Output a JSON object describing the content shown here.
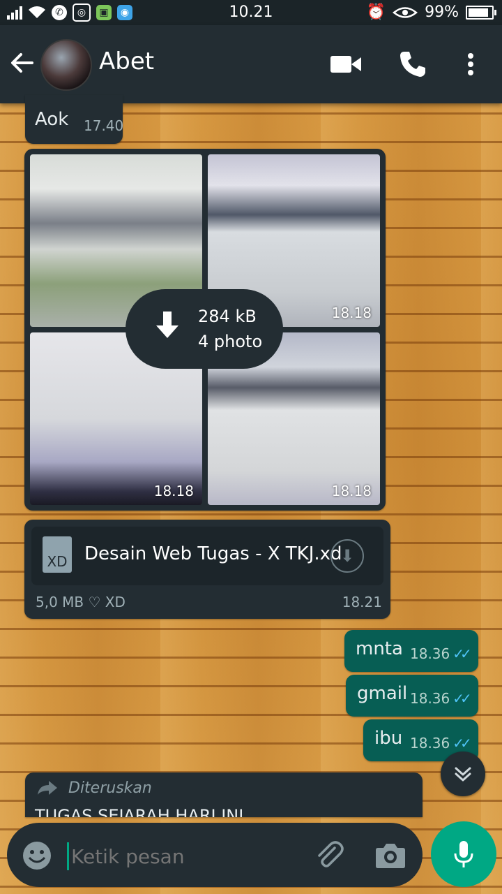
{
  "status_bar": {
    "time": "10.21",
    "battery": "99%",
    "battery_level": 0.99
  },
  "header": {
    "contact_name": "Abet",
    "icons": [
      "back-arrow-icon",
      "video-call-icon",
      "voice-call-icon",
      "more-options-icon"
    ]
  },
  "messages": {
    "m1": {
      "text": "Aok",
      "time": "17.40"
    },
    "album": {
      "size": "284 kB",
      "count": "4 photo",
      "photo_times": [
        "18.18",
        "18.18",
        "18.18"
      ]
    },
    "file": {
      "icon_label": "XD",
      "name": "Desain Web Tugas - X TKJ.xd",
      "meta": "5,0 MB ♡ XD",
      "time": "18.21"
    },
    "out1": {
      "text": "mnta",
      "time": "18.36"
    },
    "out2": {
      "text": "gmail",
      "time": "18.36"
    },
    "out3": {
      "text": "ibu",
      "time": "18.36"
    },
    "forwarded": {
      "label": "Diteruskan",
      "text": "TUGAS SEJARAH HARI INI"
    }
  },
  "input": {
    "placeholder": "Ketik pesan"
  },
  "colors": {
    "header_bg": "#232d33",
    "incoming_bubble": "#232d33",
    "outgoing_bubble": "#075e54",
    "accent": "#00a884",
    "read_ticks": "#4fc3f7"
  }
}
